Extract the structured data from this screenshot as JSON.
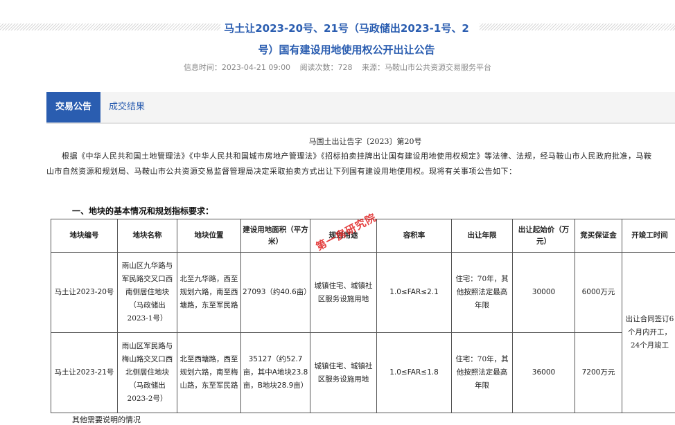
{
  "title_line1": "马土让2023-20号、21号（马政储出2023-1号、2",
  "title_line2": "号）国有建设用地使用权公开出让公告",
  "meta": {
    "time": "信息时间：2023-04-21 09:00",
    "views": "阅读次数：728",
    "source": "来源：马鞍山市公共资源交易服务平台"
  },
  "tabs": [
    "交易公告",
    "成交结果"
  ],
  "doc_number": "马国土出让告字〔2023〕第20号",
  "intro": "根据《中华人民共和国土地管理法》《中华人民共和国城市房地产管理法》《招标拍卖挂牌出让国有建设用地使用权规定》等法律、法规，经马鞍山市人民政府批准，马鞍山市自然资源和规划局、马鞍山市公共资源交易监督管理局决定采取拍卖方式出让下列国有建设用地使用权。现将有关事项公告如下：",
  "section1_heading": "一、地块的基本情况和规划指标要求：",
  "table": {
    "headers": [
      "地块编号",
      "地块名称",
      "地块位置",
      "建设用地面积（平方米）",
      "规划用途",
      "容积率",
      "出让年限",
      "出让起始价（万元）",
      "竞买保证金",
      "开竣工时间"
    ],
    "rows": [
      {
        "no": "马土让2023-20号",
        "name": "雨山区九华路与军民路交叉口西南侧居住地块（马政储出2023-1号）",
        "location": "北至九华路，西至规划六路，南至西塘路，东至军民路",
        "area": "27093（约40.6亩）",
        "use": "城镇住宅、城镇社区服务设施用地",
        "far": "1.0≤FAR≤2.1",
        "term": "住宅：70年，其他按照法定最高年限",
        "price": "30000",
        "deposit": "6000万元"
      },
      {
        "no": "马土让2023-21号",
        "name": "雨山区军民路与梅山路交叉口西北侧居住地块（马政储出2023-2号）",
        "location": "北至西塘路，西至规划六路，南至梅山路，东至军民路",
        "area": "35127（约52.7亩，其中A地块23.8亩，B地块28.9亩）",
        "use": "城镇住宅、城镇社区服务设施用地",
        "far": "1.0≤FAR≤1.8",
        "term": "住宅：70年，其他按照法定最高年限",
        "price": "36000",
        "deposit": "7200万元"
      }
    ],
    "schedule": "出让合同签订6个月内开工，24个月竣工"
  },
  "watermark": "第一房研究院",
  "footer_note": "其他需要说明的情况"
}
